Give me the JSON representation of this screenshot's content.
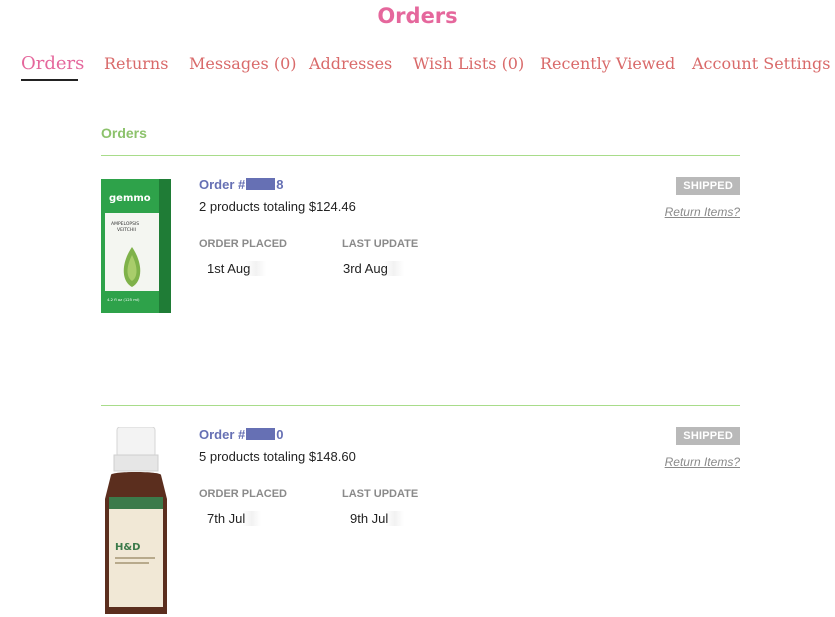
{
  "page": {
    "title": "Orders"
  },
  "tabs": [
    {
      "label": "Orders",
      "active": true
    },
    {
      "label": "Returns"
    },
    {
      "label": "Messages (0)"
    },
    {
      "label": "Addresses"
    },
    {
      "label": "Wish Lists (0)"
    },
    {
      "label": "Recently Viewed"
    },
    {
      "label": "Account Settings"
    }
  ],
  "section": {
    "label": "Orders"
  },
  "labels": {
    "order_placed": "ORDER PLACED",
    "last_update": "LAST UPDATE"
  },
  "orders": [
    {
      "order_prefix": "Order #",
      "order_suffix": "8",
      "summary": "2 products totaling $124.46",
      "placed": "1st Aug",
      "updated": "3rd Aug",
      "status": "SHIPPED",
      "return_link": "Return Items?",
      "product_image": {
        "brand": "gemmo",
        "name_line1": "AMPELOPSIS",
        "name_line2": "VEITCHII",
        "volume": "4.2 fl oz (125 ml)"
      }
    },
    {
      "order_prefix": "Order #",
      "order_suffix": "0",
      "summary": "5 products totaling $148.60",
      "placed": "7th Jul",
      "updated": "9th Jul",
      "status": "SHIPPED",
      "return_link": "Return Items?",
      "product_image": {
        "name": "H&D"
      }
    }
  ],
  "colors": {
    "title": "#e5679c",
    "tab": "#d96a6a",
    "section": "#8cc26b",
    "order_link": "#6670b4",
    "status_badge": "#b9b9b9"
  }
}
